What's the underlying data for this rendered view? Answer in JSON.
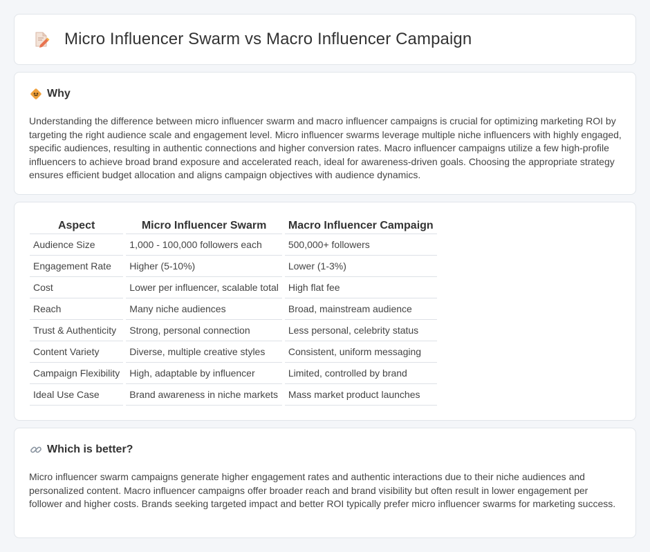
{
  "header": {
    "title": "Micro Influencer Swarm vs Macro Influencer Campaign",
    "icon": "document-edit-icon"
  },
  "why": {
    "heading": "Why",
    "icon": "diamond-sign-icon",
    "text": "Understanding the difference between micro influencer swarm and macro influencer campaigns is crucial for optimizing marketing ROI by targeting the right audience scale and engagement level. Micro influencer swarms leverage multiple niche influencers with highly engaged, specific audiences, resulting in authentic connections and higher conversion rates. Macro influencer campaigns utilize a few high-profile influencers to achieve broad brand exposure and accelerated reach, ideal for awareness-driven goals. Choosing the appropriate strategy ensures efficient budget allocation and aligns campaign objectives with audience dynamics."
  },
  "comparison": {
    "headers": [
      "Aspect",
      "Micro Influencer Swarm",
      "Macro Influencer Campaign"
    ],
    "rows": [
      [
        "Audience Size",
        "1,000 - 100,000 followers each",
        "500,000+ followers"
      ],
      [
        "Engagement Rate",
        "Higher (5-10%)",
        "Lower (1-3%)"
      ],
      [
        "Cost",
        "Lower per influencer, scalable total",
        "High flat fee"
      ],
      [
        "Reach",
        "Many niche audiences",
        "Broad, mainstream audience"
      ],
      [
        "Trust & Authenticity",
        "Strong, personal connection",
        "Less personal, celebrity status"
      ],
      [
        "Content Variety",
        "Diverse, multiple creative styles",
        "Consistent, uniform messaging"
      ],
      [
        "Campaign Flexibility",
        "High, adaptable by influencer",
        "Limited, controlled by brand"
      ],
      [
        "Ideal Use Case",
        "Brand awareness in niche markets",
        "Mass market product launches"
      ]
    ]
  },
  "better": {
    "heading": "Which is better?",
    "icon": "link-icon",
    "text": "Micro influencer swarm campaigns generate higher engagement rates and authentic interactions due to their niche audiences and personalized content. Macro influencer campaigns offer broader reach and brand visibility but often result in lower engagement per follower and higher costs. Brands seeking targeted impact and better ROI typically prefer micro influencer swarms for marketing success."
  },
  "colors": {
    "background": "#f4f6f9",
    "card": "#ffffff",
    "accent_orange": "#f0a13c",
    "border": "#e1e5ea"
  }
}
